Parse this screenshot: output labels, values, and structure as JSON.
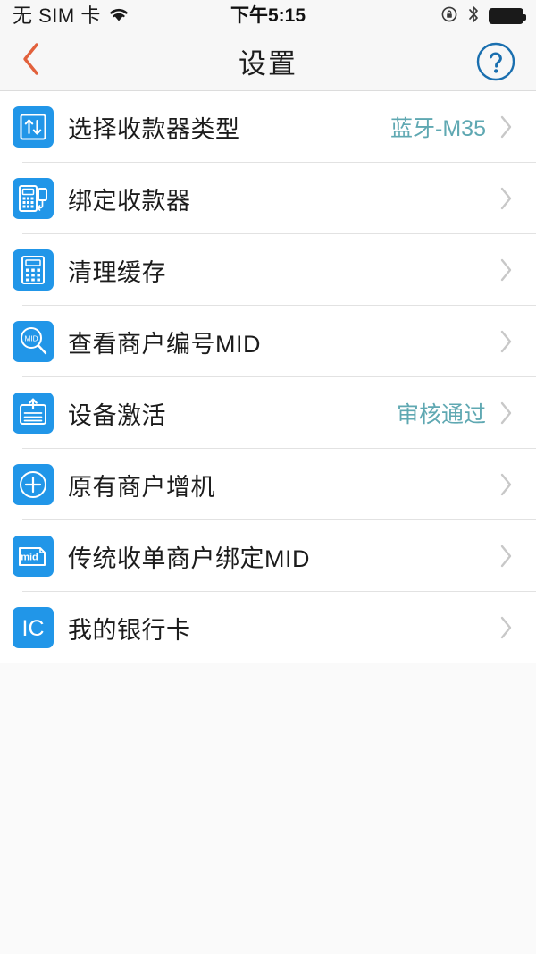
{
  "status_bar": {
    "carrier": "无 SIM 卡",
    "wifi_icon": "wifi-icon",
    "time": "下午5:15",
    "rotation_lock_icon": "rotation-lock-icon",
    "bluetooth_icon": "bluetooth-icon",
    "battery_icon": "battery-full-icon"
  },
  "nav_bar": {
    "back_icon": "chevron-left-icon",
    "title": "设置",
    "help_icon": "question-mark-circle-icon"
  },
  "colors": {
    "icon_blue": "#2196e8",
    "value_teal": "#5fa8b2",
    "back_orange": "#e2613c",
    "help_blue": "#1a6faf",
    "chevron_gray": "#c8c8c8",
    "page_bg": "#fafafa",
    "row_bg": "#ffffff",
    "separator": "#e2e2e2"
  },
  "list": {
    "rows": [
      {
        "label": "选择收款器类型",
        "value": "蓝牙-M35",
        "icon": "arrows-up-down-square-icon",
        "chevron": "chevron-right-icon"
      },
      {
        "label": "绑定收款器",
        "value": "",
        "icon": "pos-terminal-link-icon",
        "chevron": "chevron-right-icon"
      },
      {
        "label": "清理缓存",
        "value": "",
        "icon": "calculator-icon",
        "chevron": "chevron-right-icon"
      },
      {
        "label": "查看商户编号MID",
        "value": "",
        "icon": "magnifier-mid-icon",
        "chevron": "chevron-right-icon"
      },
      {
        "label": "设备激活",
        "value": "审核通过",
        "icon": "document-upload-icon",
        "chevron": "chevron-right-icon"
      },
      {
        "label": "原有商户增机",
        "value": "",
        "icon": "plus-circle-icon",
        "chevron": "chevron-right-icon"
      },
      {
        "label": "传统收单商户绑定MID",
        "value": "",
        "icon": "mid-card-icon",
        "chevron": "chevron-right-icon"
      },
      {
        "label": "我的银行卡",
        "value": "",
        "icon": "ic-card-icon",
        "chevron": "chevron-right-icon"
      }
    ]
  }
}
